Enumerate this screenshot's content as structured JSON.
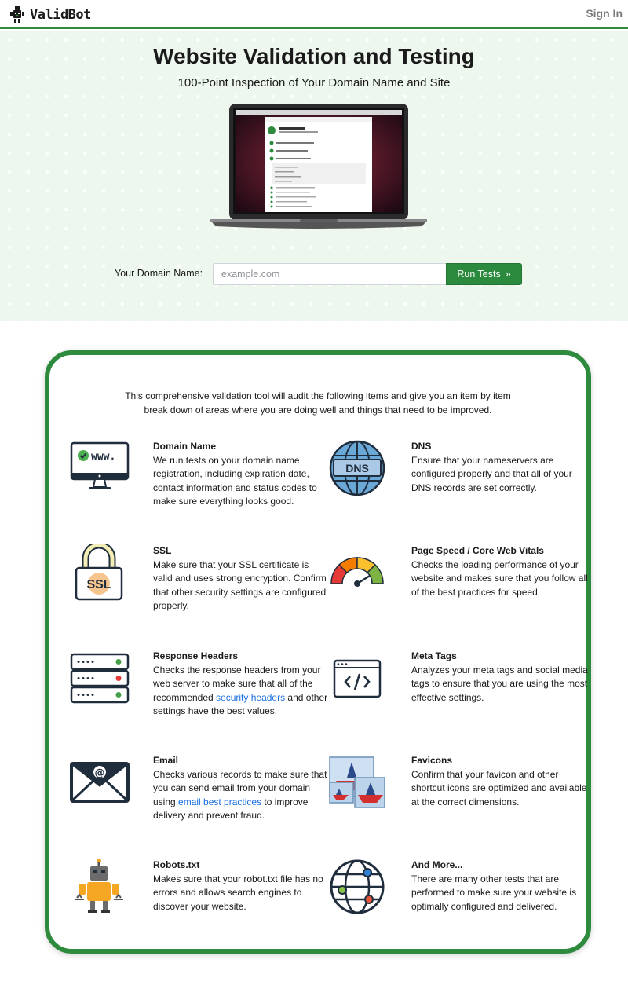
{
  "nav": {
    "logo_text": "ValidBot",
    "signin": "Sign In"
  },
  "hero": {
    "title": "Website Validation and Testing",
    "subtitle": "100-Point Inspection of Your Domain Name and Site",
    "domain_label": "Your Domain Name:",
    "domain_placeholder": "example.com",
    "run_button": "Run Tests",
    "run_icon": "»"
  },
  "features": {
    "intro": "This comprehensive validation tool will audit the following items and give you an item by item break down of areas where you are doing well and things that need to be improved.",
    "items": [
      {
        "title": "Domain Name",
        "icon": "monitor-www-icon",
        "desc": "We run tests on your domain name registration, including expiration date, contact information and status codes to make sure everything looks good."
      },
      {
        "title": "DNS",
        "icon": "globe-dns-icon",
        "desc": "Ensure that your nameservers are configured properly and that all of your DNS records are set correctly."
      },
      {
        "title": "SSL",
        "icon": "padlock-ssl-icon",
        "desc": "Make sure that your SSL certificate is valid and uses strong encryption. Confirm that other security settings are configured properly."
      },
      {
        "title": "Page Speed / Core Web Vitals",
        "icon": "speedometer-icon",
        "desc": "Checks the loading performance of your website and makes sure that you follow all of the best practices for speed."
      },
      {
        "title": "Response Headers",
        "icon": "server-rack-icon",
        "desc_before": "Checks the response headers from your web server to make sure that all of the recommended ",
        "link": "security headers",
        "desc_after": " and other settings have the best values."
      },
      {
        "title": "Meta Tags",
        "icon": "code-window-icon",
        "desc": "Analyzes your meta tags and social media tags to ensure that you are using the most effective settings."
      },
      {
        "title": "Email",
        "icon": "email-envelope-icon",
        "desc_before": "Checks various records to make sure that you can send email from your domain using ",
        "link": "email best practices",
        "desc_after": " to improve delivery and prevent fraud."
      },
      {
        "title": "Favicons",
        "icon": "favicons-icon",
        "desc": "Confirm that your favicon and other shortcut icons are optimized and available at the correct dimensions."
      },
      {
        "title": "Robots.txt",
        "icon": "robot-icon",
        "desc": "Makes sure that your robot.txt file has no errors and allows search engines to discover your website."
      },
      {
        "title": "And More...",
        "icon": "network-globe-icon",
        "desc": "There are many other tests that are performed to make sure your website is optimally configured and delivered."
      }
    ]
  },
  "colors": {
    "brand_green": "#2e8b3e",
    "button_green": "#2b8a3e",
    "link_blue": "#1a6fe0",
    "hero_bg": "#eef7ee"
  }
}
